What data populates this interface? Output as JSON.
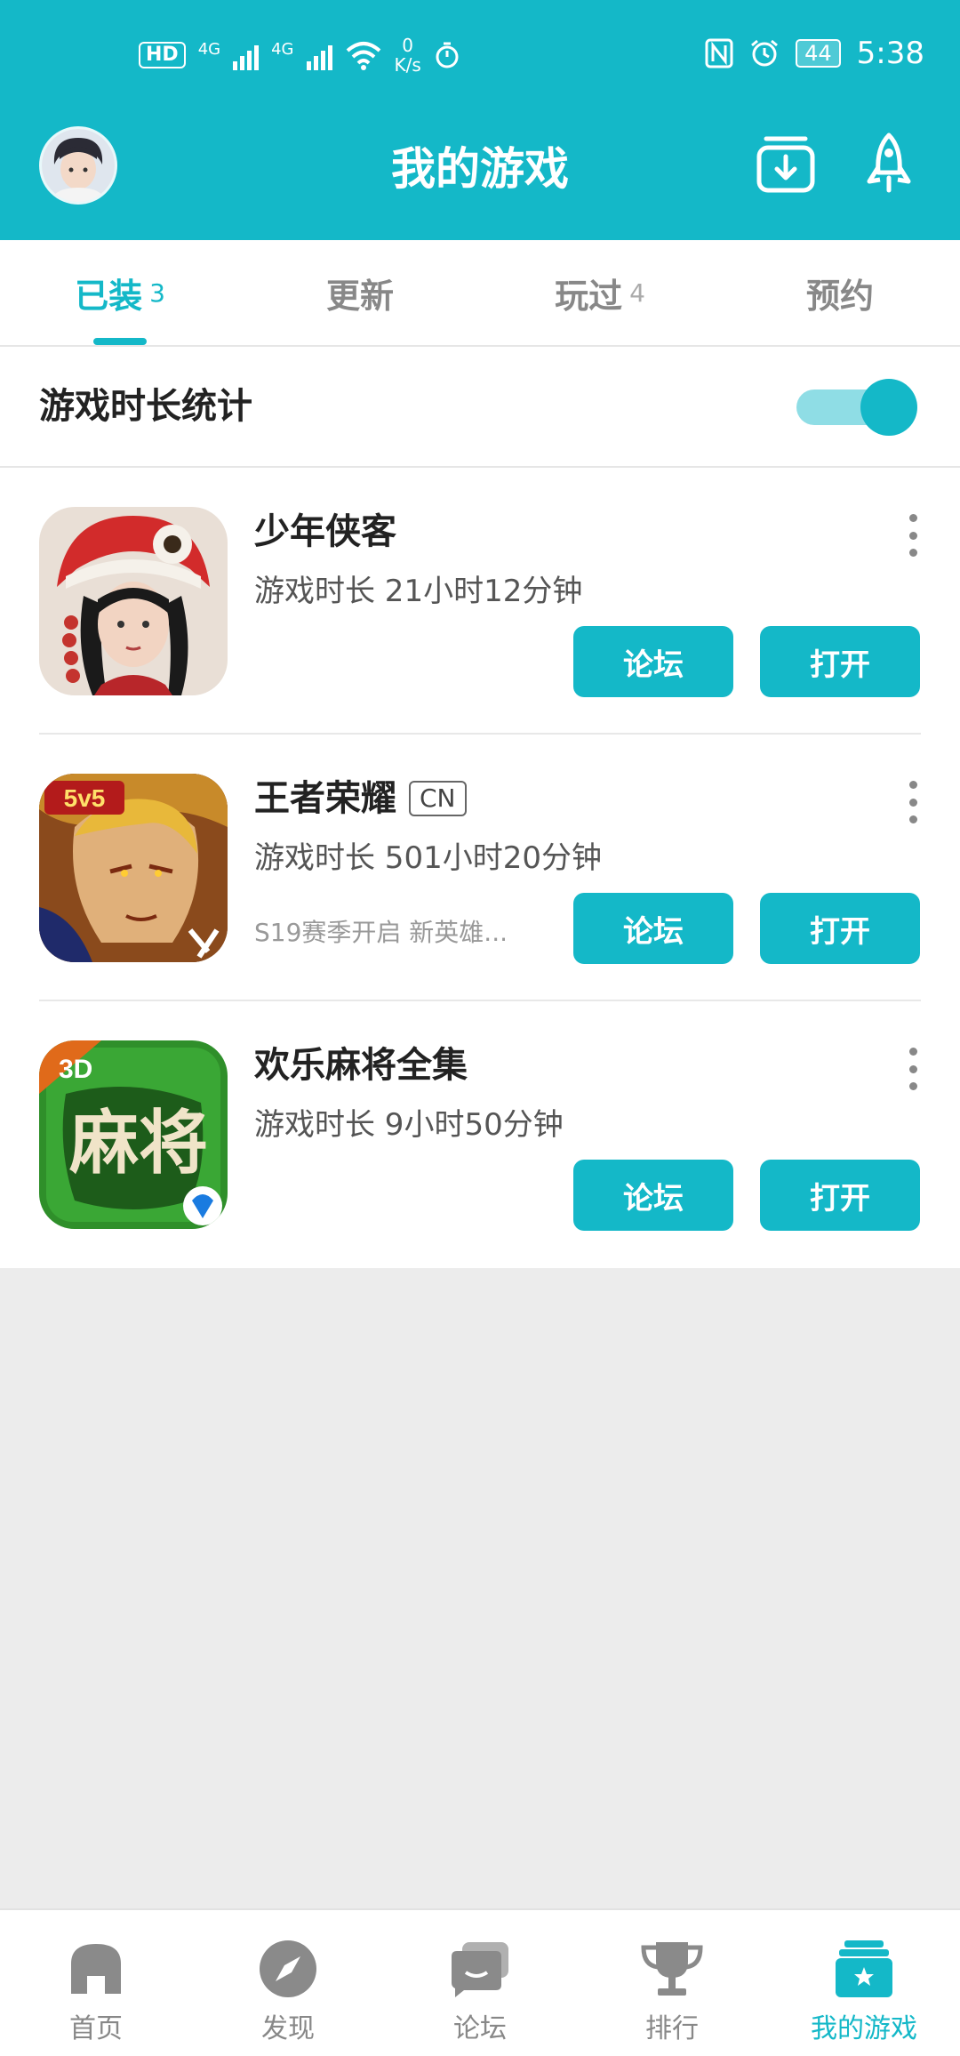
{
  "status_bar": {
    "left_badge": "HD",
    "sim1": "4G",
    "sim2": "4G",
    "speed_value": "0",
    "speed_unit": "K/s",
    "battery": "44",
    "time": "5:38"
  },
  "header": {
    "title": "我的游戏",
    "accent_color": "#14b8c8"
  },
  "tabs": [
    {
      "label": "已装",
      "count": "3",
      "active": true
    },
    {
      "label": "更新",
      "count": "",
      "active": false
    },
    {
      "label": "玩过",
      "count": "4",
      "active": false
    },
    {
      "label": "预约",
      "count": "",
      "active": false
    }
  ],
  "stats": {
    "label": "游戏时长统计",
    "toggle_on": true
  },
  "games": [
    {
      "name": "少年侠客",
      "tag": "",
      "time": "游戏时长 21小时12分钟",
      "news": "",
      "forum_label": "论坛",
      "open_label": "打开",
      "icon": "shaonian-xiake-icon"
    },
    {
      "name": "王者荣耀",
      "tag": "CN",
      "time": "游戏时长 501小时20分钟",
      "news": "S19赛季开启 新英雄...",
      "forum_label": "论坛",
      "open_label": "打开",
      "icon": "wangzhe-rongyao-icon"
    },
    {
      "name": "欢乐麻将全集",
      "tag": "",
      "time": "游戏时长 9小时50分钟",
      "news": "",
      "forum_label": "论坛",
      "open_label": "打开",
      "icon": "huanle-majiang-icon",
      "icon_text": "麻将",
      "icon_badge": "3D"
    }
  ],
  "bottom_nav": [
    {
      "label": "首页",
      "icon": "home-icon",
      "active": false
    },
    {
      "label": "发现",
      "icon": "compass-icon",
      "active": false
    },
    {
      "label": "论坛",
      "icon": "chat-icon",
      "active": false
    },
    {
      "label": "排行",
      "icon": "trophy-icon",
      "active": false
    },
    {
      "label": "我的游戏",
      "icon": "my-games-icon",
      "active": true
    }
  ]
}
